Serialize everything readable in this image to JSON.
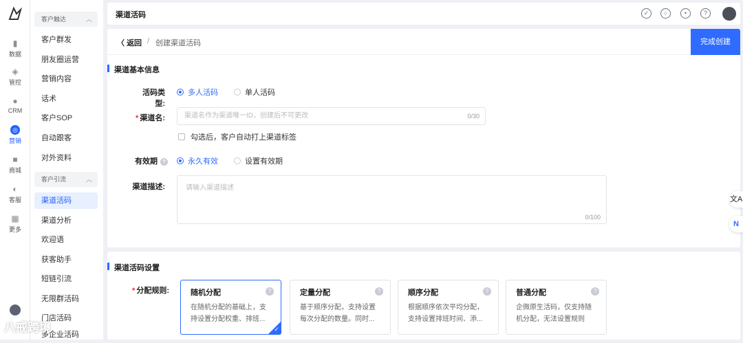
{
  "rail": {
    "items": [
      {
        "label": "数据",
        "icon": "chart-bar-icon"
      },
      {
        "label": "管控",
        "icon": "shield-icon"
      },
      {
        "label": "CRM",
        "icon": "user-icon"
      },
      {
        "label": "营销",
        "icon": "target-icon"
      },
      {
        "label": "商城",
        "icon": "bag-icon"
      },
      {
        "label": "客服",
        "icon": "headset-icon"
      },
      {
        "label": "更多",
        "icon": "grid-icon"
      }
    ]
  },
  "sidebar": {
    "group1": "客户触达",
    "group1_items": [
      "客户群发",
      "朋友圈运营",
      "营销内容",
      "话术",
      "客户SOP",
      "自动跟客",
      "对外资料"
    ],
    "group2": "客户引流",
    "group2_items": [
      "渠道活码",
      "渠道分析",
      "欢迎语",
      "获客助手",
      "短链引流",
      "无限群活码",
      "门店活码",
      "多企业活码"
    ]
  },
  "topbar": {
    "title": "渠道活码"
  },
  "header": {
    "back": "返回",
    "separator": "/",
    "crumb": "创建渠道活码",
    "done": "完成创建"
  },
  "basic": {
    "title": "渠道基本信息",
    "type_label": "活码类型:",
    "type_options": [
      "多人活码",
      "单人活码"
    ],
    "name_label": "渠道名:",
    "name_placeholder": "渠道名作为渠道唯一ID，创建后不可更改",
    "name_count": "0/30",
    "tag_check": "勾选后，客户自动打上渠道标签",
    "validity_label": "有效期",
    "validity_options": [
      "永久有效",
      "设置有效期"
    ],
    "desc_label": "渠道描述:",
    "desc_placeholder": "请输入渠道描述",
    "desc_count": "0/100"
  },
  "settings": {
    "title": "渠道活码设置",
    "rule_label": "分配规则:",
    "cards": [
      {
        "title": "随机分配",
        "line1": "在随机分配的基础上，支",
        "line2": "持设置分配权重、排班..."
      },
      {
        "title": "定量分配",
        "line1": "基于顺序分配，支持设置",
        "line2": "每次分配的数量。同时..."
      },
      {
        "title": "顺序分配",
        "line1": "根据顺序依次平均分配，",
        "line2": "支持设置排班时间、添..."
      },
      {
        "title": "普通分配",
        "line1": "企微原生活码，仅支持随",
        "line2": "机分配，无法设置规则"
      }
    ]
  },
  "float": {
    "translate": "文A",
    "ai": "N"
  },
  "brand": "八戒跨境",
  "colors": {
    "accent": "#2f6bff",
    "required": "#f5222d"
  }
}
